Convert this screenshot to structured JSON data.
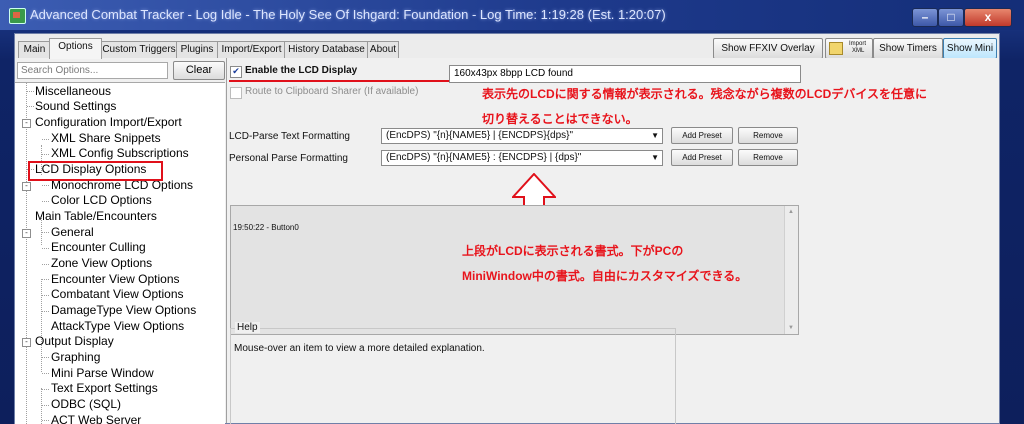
{
  "window": {
    "title": "Advanced Combat Tracker - Log Idle - The Holy See Of Ishgard: Foundation - Log Time: 1:19:28 (Est. 1:20:07)",
    "controls": {
      "minimize": "–",
      "maximize": "□",
      "close": "x"
    }
  },
  "tabs": [
    "Main",
    "Options",
    "Custom Triggers",
    "Plugins",
    "Import/Export",
    "History Database",
    "About"
  ],
  "active_tab": "Options",
  "toolbar": {
    "ffxiv_overlay": "Show FFXIV Overlay",
    "import_top": "Import",
    "import_bottom": "XML",
    "show_timers": "Show Timers",
    "show_mini": "Show Mini"
  },
  "search": {
    "placeholder": "Search Options...",
    "clear": "Clear"
  },
  "tree": {
    "n0": "Miscellaneous",
    "n1": "Sound Settings",
    "n2": "Configuration Import/Export",
    "n3": "XML Share Snippets",
    "n4": "XML Config Subscriptions",
    "n5": "LCD Display Options",
    "n6": "Monochrome LCD Options",
    "n7": "Color LCD Options",
    "n8": "Main Table/Encounters",
    "n9": "General",
    "n10": "Encounter Culling",
    "n11": "Zone View Options",
    "n12": "Encounter View Options",
    "n13": "Combatant View Options",
    "n14": "DamageType View Options",
    "n15": "AttackType View Options",
    "n16": "Output Display",
    "n17": "Graphing",
    "n18": "Mini Parse Window",
    "n19": "Text Export Settings",
    "n20": "ODBC (SQL)",
    "n21": "ACT Web Server"
  },
  "lcd": {
    "enable_label": "Enable the LCD Display",
    "enable_checked": true,
    "device_status": "160x43px 8bpp LCD found",
    "route_label": "Route to Clipboard Sharer (If available)",
    "route_checked": false,
    "lcd_format_label": "LCD-Parse Text Formatting",
    "lcd_format_value": "(EncDPS) \"{n}{NAME5} | {ENCDPS}{dps}\"",
    "personal_label": "Personal Parse Formatting",
    "personal_value": "(EncDPS) \"{n}{NAME5} : {ENCDPS} | {dps}\"",
    "add_preset": "Add Preset",
    "remove": "Remove",
    "preview_text": "19:50:22 - Button0"
  },
  "help": {
    "title": "Help",
    "body": "Mouse-over an item to view a more detailed explanation."
  },
  "annotations": {
    "device_line1": "表示先のLCDに関する情報が表示される。残念ながら複数のLCDデバイスを任意に",
    "device_line2": "切り替えることはできない。",
    "format_line1": "上段がLCDに表示される書式。下がPCの",
    "format_line2": "MiniWindow中の書式。自由にカスタマイズできる。"
  },
  "colors": {
    "annotation_red": "#e8141c",
    "window_frame": "#0d1f5c",
    "selection_box": "#e0101a"
  }
}
